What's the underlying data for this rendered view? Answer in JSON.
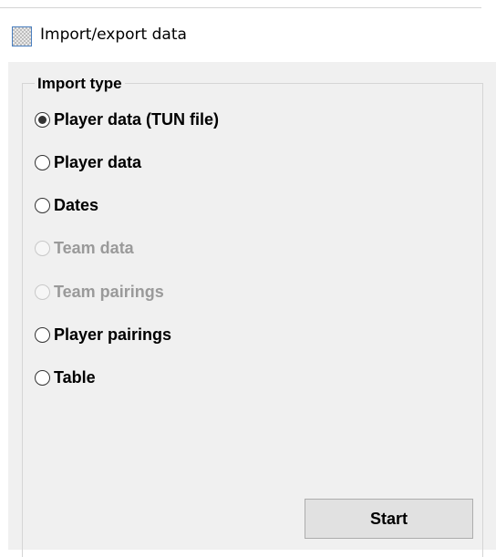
{
  "window": {
    "title": "Import/export data",
    "icon": "app-grid-icon"
  },
  "import_type": {
    "label": "Import type",
    "options": [
      {
        "label": "Player data (TUN file)",
        "selected": true,
        "enabled": true
      },
      {
        "label": "Player data",
        "selected": false,
        "enabled": true
      },
      {
        "label": "Dates",
        "selected": false,
        "enabled": true
      },
      {
        "label": "Team data",
        "selected": false,
        "enabled": false
      },
      {
        "label": "Team pairings",
        "selected": false,
        "enabled": false
      },
      {
        "label": "Player pairings",
        "selected": false,
        "enabled": true
      },
      {
        "label": "Table",
        "selected": false,
        "enabled": true
      }
    ]
  },
  "actions": {
    "start_label": "Start"
  },
  "colors": {
    "dialog_bg": "#f0f0f0",
    "disabled_text": "#9a9a9a",
    "button_bg": "#e1e1e1"
  }
}
